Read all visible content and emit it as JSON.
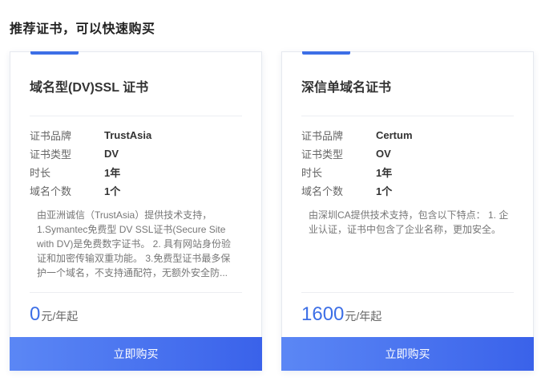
{
  "section": {
    "title": "推荐证书，可以快速购买"
  },
  "colors": {
    "accent": "#3d6fe6",
    "button_start": "#5b87f5",
    "button_end": "#3a62ea"
  },
  "cards": [
    {
      "title": "域名型(DV)SSL 证书",
      "specs": [
        {
          "key": "证书品牌",
          "value": "TrustAsia"
        },
        {
          "key": "证书类型",
          "value": "DV"
        },
        {
          "key": "时长",
          "value": "1年"
        },
        {
          "key": "域名个数",
          "value": "1个"
        }
      ],
      "description": "由亚洲诚信（TrustAsia）提供技术支持，1.Symantec免费型 DV SSL证书(Secure Site with DV)是免费数字证书。 2. 具有网站身份验证和加密传输双重功能。 3.免费型证书最多保护一个域名，不支持通配符，无额外安全防...",
      "price": "0",
      "price_unit": "元/年起",
      "buy_label": "立即购买"
    },
    {
      "title": "深信单域名证书",
      "specs": [
        {
          "key": "证书品牌",
          "value": "Certum"
        },
        {
          "key": "证书类型",
          "value": "OV"
        },
        {
          "key": "时长",
          "value": "1年"
        },
        {
          "key": "域名个数",
          "value": "1个"
        }
      ],
      "description": "由深圳CA提供技术支持，包含以下特点： 1. 企业认证，证书中包含了企业名称，更加安全。",
      "price": "1600",
      "price_unit": "元/年起",
      "buy_label": "立即购买"
    }
  ]
}
